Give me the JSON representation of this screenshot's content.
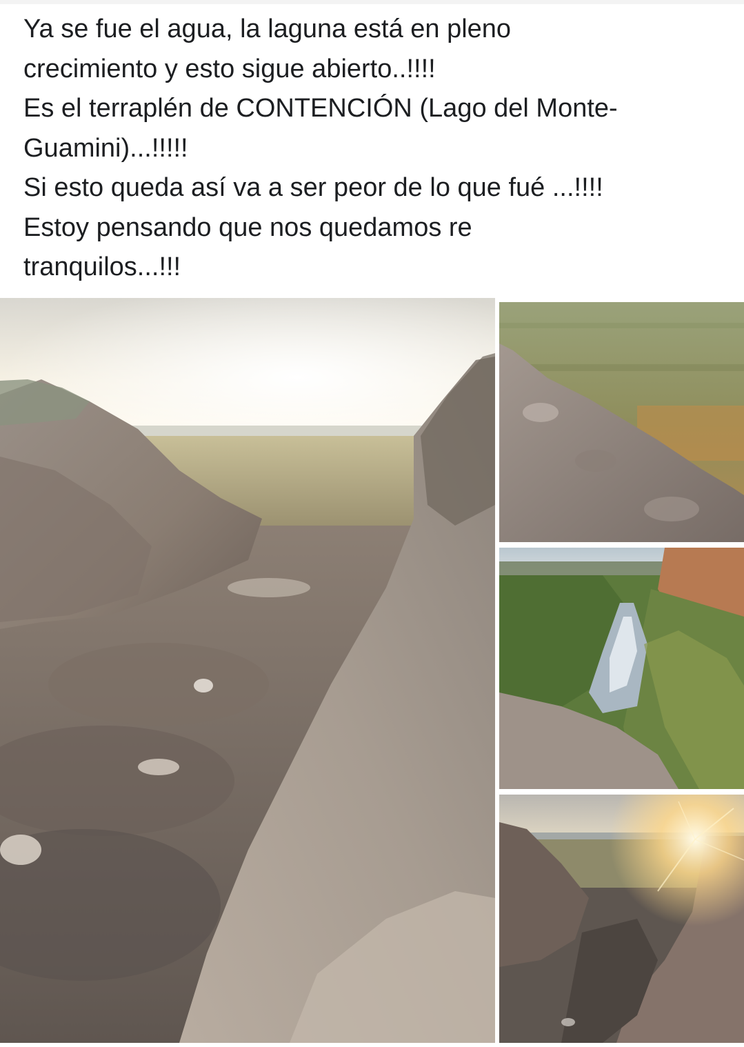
{
  "post": {
    "text_lines": [
      "Ya se fue el agua, la laguna está en pleno",
      "crecimiento y esto sigue abierto..!!!!",
      "Es el terraplén de CONTENCIÓN (Lago del Monte-",
      "Guamini)...!!!!!",
      "Si esto queda así va a ser peor de lo que fué ...!!!!",
      "Estoy pensando que nos quedamos re",
      "tranquilos...!!!"
    ]
  },
  "gallery": {
    "photos": [
      {
        "name": "embankment-breach-sunset-photo"
      },
      {
        "name": "dirt-mound-field-photo"
      },
      {
        "name": "stream-channel-photo"
      },
      {
        "name": "channel-sunrise-photo"
      }
    ]
  },
  "colors": {
    "text": "#1c1e21",
    "background": "#ffffff"
  }
}
